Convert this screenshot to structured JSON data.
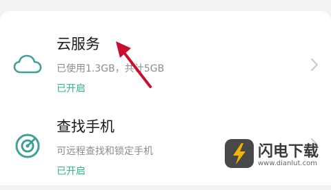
{
  "settings": {
    "items": [
      {
        "title": "云服务",
        "subtitle": "已使用1.3GB，共计5GB",
        "status": "已开启",
        "icon": "cloud-icon"
      },
      {
        "title": "查找手机",
        "subtitle": "可远程查找和锁定手机",
        "status": "已开启",
        "icon": "radar-target-icon"
      }
    ]
  },
  "watermark": {
    "name": "闪电下载",
    "url": "www.dianlut.com"
  },
  "colors": {
    "status": "#2eb38a",
    "icon": "#3f9e98",
    "arrow": "#c8102e",
    "chevron": "#c8c8c8"
  }
}
